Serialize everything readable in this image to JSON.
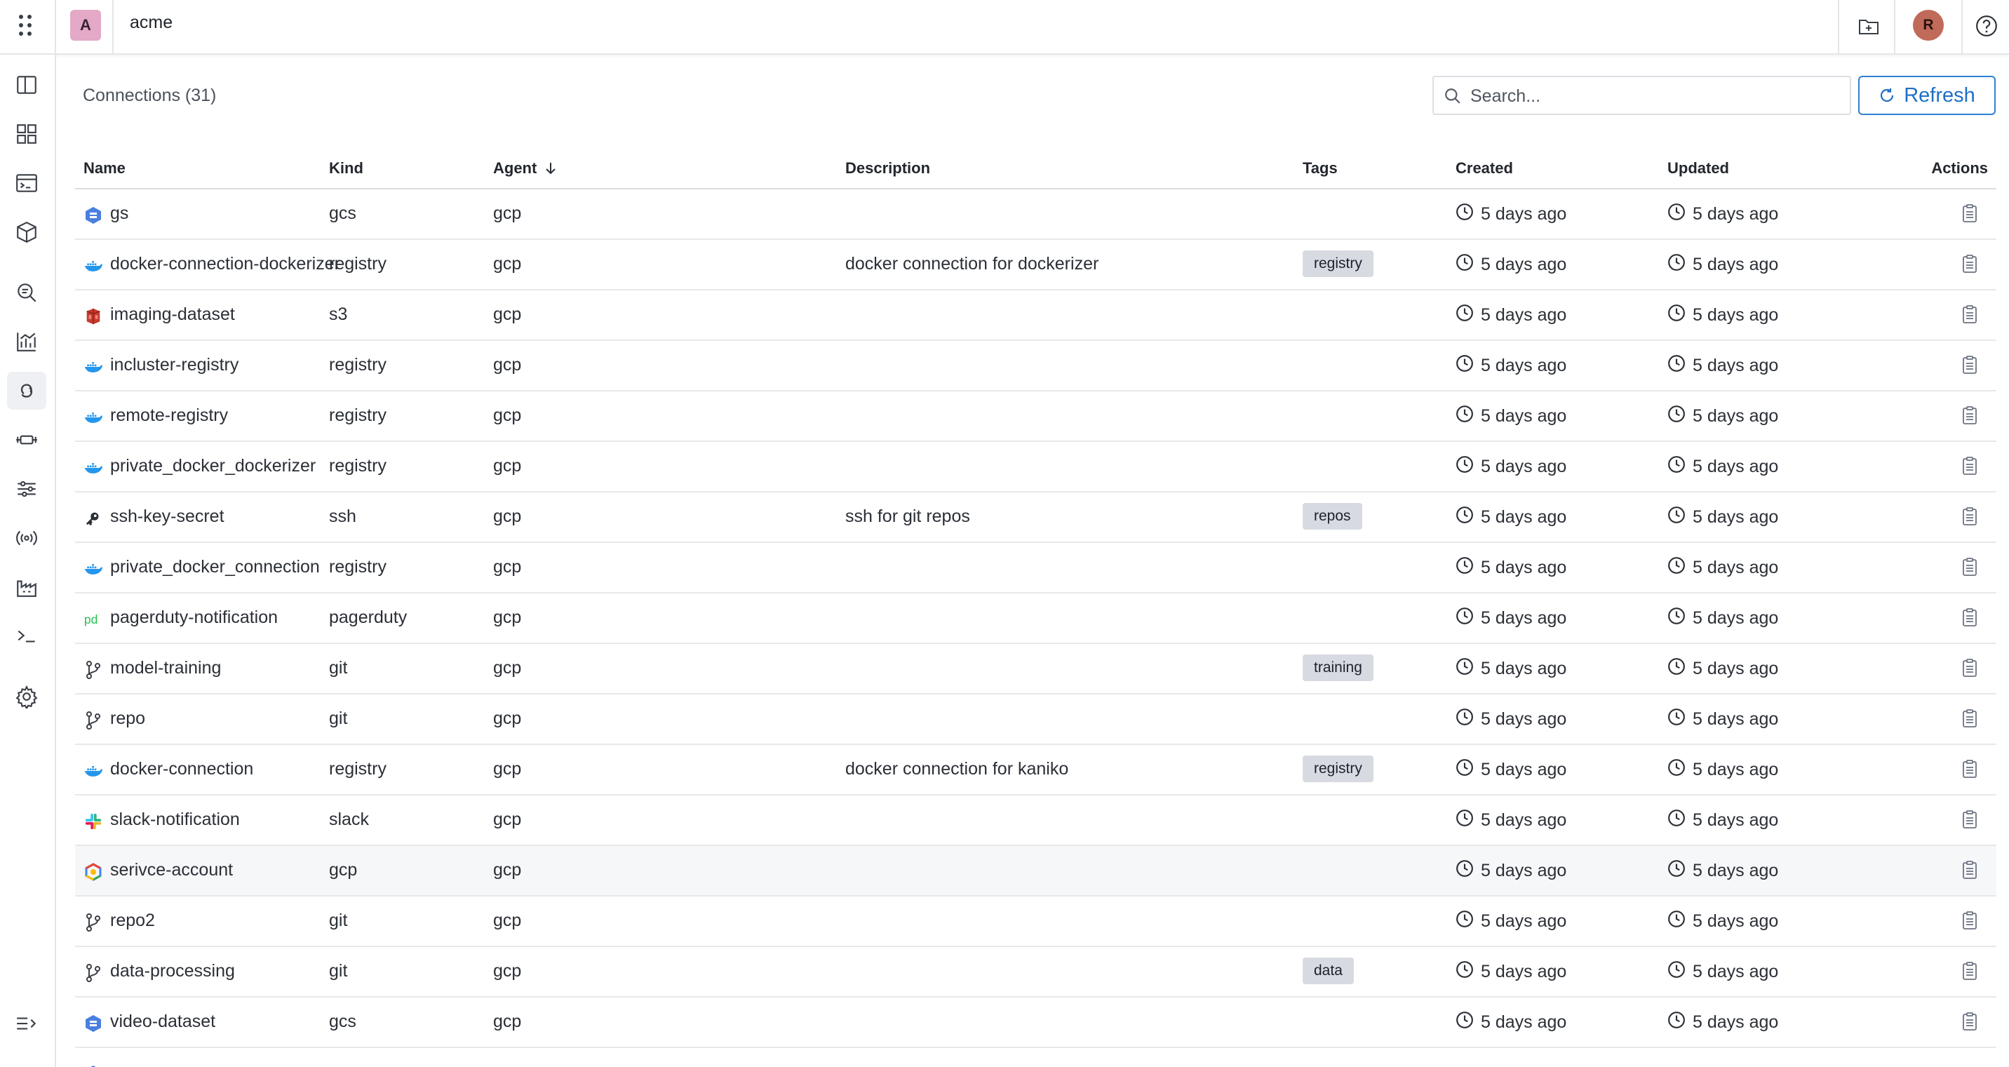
{
  "topbar": {
    "org_initial": "A",
    "org_name": "acme",
    "user_initial": "R"
  },
  "sidebar": {
    "items": [
      {
        "name": "sidebar-item-layout",
        "icon": "split-panel-icon"
      },
      {
        "name": "sidebar-item-dashboards",
        "icon": "grid-icon"
      },
      {
        "name": "sidebar-item-console",
        "icon": "terminal-window-icon"
      },
      {
        "name": "sidebar-item-packages",
        "icon": "cube-icon"
      },
      {
        "name": "sidebar-item-explore",
        "icon": "search-doc-icon"
      },
      {
        "name": "sidebar-item-metrics",
        "icon": "chart-icon"
      },
      {
        "name": "sidebar-item-connections",
        "icon": "link-icon",
        "active": true
      },
      {
        "name": "sidebar-item-pipelines",
        "icon": "pipeline-icon"
      },
      {
        "name": "sidebar-item-filters",
        "icon": "sliders-icon"
      },
      {
        "name": "sidebar-item-broadcast",
        "icon": "broadcast-icon"
      },
      {
        "name": "sidebar-item-factory",
        "icon": "factory-icon"
      },
      {
        "name": "sidebar-item-terminal",
        "icon": "prompt-icon"
      },
      {
        "name": "sidebar-item-settings",
        "icon": "gear-icon"
      },
      {
        "name": "sidebar-item-expand",
        "icon": "expand-menu-icon"
      }
    ]
  },
  "main": {
    "title": "Connections (31)",
    "search_placeholder": "Search...",
    "refresh_label": "Refresh"
  },
  "table": {
    "columns": {
      "name": "Name",
      "kind": "Kind",
      "agent": "Agent",
      "description": "Description",
      "tags": "Tags",
      "created": "Created",
      "updated": "Updated",
      "actions": "Actions"
    },
    "sort_column": "agent",
    "rows": [
      {
        "icon": "gcs-icon",
        "name": "gs",
        "kind": "gcs",
        "agent": "gcp",
        "description": "",
        "tag": "",
        "created": "5 days ago",
        "updated": "5 days ago"
      },
      {
        "icon": "docker-icon",
        "name": "docker-connection-dockerizer",
        "kind": "registry",
        "agent": "gcp",
        "description": "docker connection for dockerizer",
        "tag": "registry",
        "created": "5 days ago",
        "updated": "5 days ago"
      },
      {
        "icon": "s3-icon",
        "name": "imaging-dataset",
        "kind": "s3",
        "agent": "gcp",
        "description": "",
        "tag": "",
        "created": "5 days ago",
        "updated": "5 days ago"
      },
      {
        "icon": "docker-icon",
        "name": "incluster-registry",
        "kind": "registry",
        "agent": "gcp",
        "description": "",
        "tag": "",
        "created": "5 days ago",
        "updated": "5 days ago"
      },
      {
        "icon": "docker-icon",
        "name": "remote-registry",
        "kind": "registry",
        "agent": "gcp",
        "description": "",
        "tag": "",
        "created": "5 days ago",
        "updated": "5 days ago"
      },
      {
        "icon": "docker-icon",
        "name": "private_docker_dockerizer",
        "kind": "registry",
        "agent": "gcp",
        "description": "",
        "tag": "",
        "created": "5 days ago",
        "updated": "5 days ago"
      },
      {
        "icon": "key-icon",
        "name": "ssh-key-secret",
        "kind": "ssh",
        "agent": "gcp",
        "description": "ssh for git repos",
        "tag": "repos",
        "created": "5 days ago",
        "updated": "5 days ago"
      },
      {
        "icon": "docker-icon",
        "name": "private_docker_connection",
        "kind": "registry",
        "agent": "gcp",
        "description": "",
        "tag": "",
        "created": "5 days ago",
        "updated": "5 days ago"
      },
      {
        "icon": "pagerduty-icon",
        "name": "pagerduty-notification",
        "kind": "pagerduty",
        "agent": "gcp",
        "description": "",
        "tag": "",
        "created": "5 days ago",
        "updated": "5 days ago"
      },
      {
        "icon": "git-branch-icon",
        "name": "model-training",
        "kind": "git",
        "agent": "gcp",
        "description": "",
        "tag": "training",
        "created": "5 days ago",
        "updated": "5 days ago"
      },
      {
        "icon": "git-branch-icon",
        "name": "repo",
        "kind": "git",
        "agent": "gcp",
        "description": "",
        "tag": "",
        "created": "5 days ago",
        "updated": "5 days ago"
      },
      {
        "icon": "docker-icon",
        "name": "docker-connection",
        "kind": "registry",
        "agent": "gcp",
        "description": "docker connection for kaniko",
        "tag": "registry",
        "created": "5 days ago",
        "updated": "5 days ago"
      },
      {
        "icon": "slack-icon",
        "name": "slack-notification",
        "kind": "slack",
        "agent": "gcp",
        "description": "",
        "tag": "",
        "created": "5 days ago",
        "updated": "5 days ago"
      },
      {
        "icon": "gcp-icon",
        "name": "serivce-account",
        "kind": "gcp",
        "agent": "gcp",
        "description": "",
        "tag": "",
        "created": "5 days ago",
        "updated": "5 days ago",
        "hover": true
      },
      {
        "icon": "git-branch-icon",
        "name": "repo2",
        "kind": "git",
        "agent": "gcp",
        "description": "",
        "tag": "",
        "created": "5 days ago",
        "updated": "5 days ago"
      },
      {
        "icon": "git-branch-icon",
        "name": "data-processing",
        "kind": "git",
        "agent": "gcp",
        "description": "",
        "tag": "data",
        "created": "5 days ago",
        "updated": "5 days ago"
      },
      {
        "icon": "gcs-icon",
        "name": "video-dataset",
        "kind": "gcs",
        "agent": "gcp",
        "description": "",
        "tag": "",
        "created": "5 days ago",
        "updated": "5 days ago"
      },
      {
        "icon": "gcs-icon",
        "name": "",
        "kind": "",
        "agent": "",
        "description": "",
        "tag": "",
        "created": "",
        "updated": ""
      }
    ]
  },
  "colors": {
    "accent": "#1f6fc6",
    "tag_bg": "#d7dbe1",
    "border": "#e6e8eb",
    "docker": "#2496ed",
    "pagerduty": "#25c151",
    "s3": "#c7392e",
    "gcs": "#4a7fe0"
  }
}
